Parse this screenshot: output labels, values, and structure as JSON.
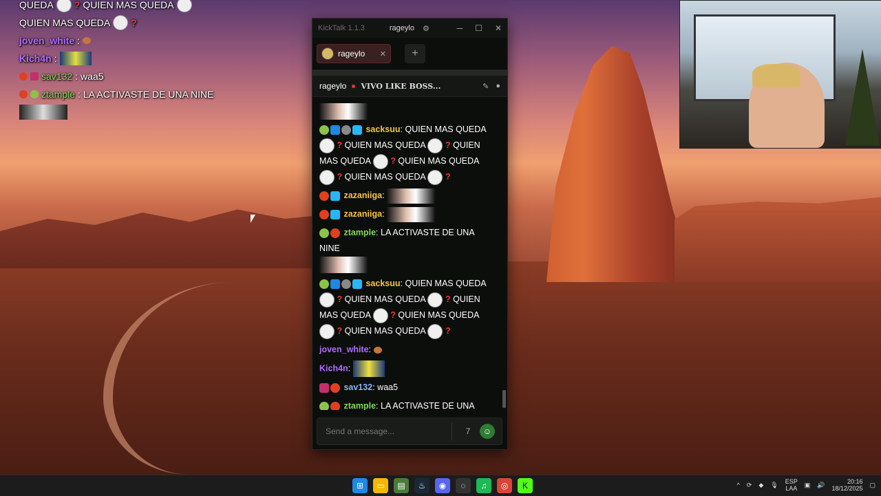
{
  "overlay": {
    "lines": [
      {
        "text1": "QUEDA",
        "text2": "QUIEN MAS QUEDA"
      },
      {
        "text1": "QUIEN MAS QUEDA"
      },
      {
        "user": "joven_white",
        "sep": ":"
      },
      {
        "user": "Kich4n",
        "sep": ":"
      },
      {
        "user": "sav132",
        "sep": ":",
        "text": "waa5"
      },
      {
        "user": "ztample",
        "sep": ":",
        "text": "LA ACTIVASTE DE UNA NINE"
      }
    ]
  },
  "kicktalk": {
    "app_title": "KickTalk 1.1.3",
    "account": "rageylo",
    "window_controls": {
      "minimize": "─",
      "maximize": "☐",
      "close": "✕"
    },
    "tab": {
      "label": "rageylo",
      "close": "✕"
    },
    "add_tab": "+",
    "channel": {
      "name": "rageylo",
      "stream_title": "VIVO LIKE BOSS..."
    },
    "messages": [
      {
        "user": "sacksuu",
        "sep": ":",
        "t1": "QUIEN MAS QUEDA",
        "t2": "QUIEN MAS QUEDA",
        "t3": "QUIEN",
        "t4": "MAS QUEDA",
        "t5": "QUIEN MAS QUEDA",
        "t6": "QUIEN MAS QUEDA"
      },
      {
        "user": "zazaniiga",
        "sep": ":"
      },
      {
        "user": "zazaniiga",
        "sep": ":"
      },
      {
        "user": "ztample",
        "sep": ":",
        "text": "LA ACTIVASTE DE UNA NINE"
      },
      {
        "user": "sacksuu",
        "sep": ":",
        "t1": "QUIEN MAS QUEDA",
        "t2": "QUIEN MAS QUEDA",
        "t3": "QUIEN",
        "t4": "MAS QUEDA",
        "t5": "QUIEN MAS QUEDA",
        "t6": "QUIEN MAS QUEDA"
      },
      {
        "user": "joven_white",
        "sep": ":"
      },
      {
        "user": "Kich4n",
        "sep": ":"
      },
      {
        "user": "sav132",
        "sep": ":",
        "text": "waa5"
      },
      {
        "user": "ztample",
        "sep": ":",
        "text": "LA ACTIVASTE DE UNA NINE"
      }
    ],
    "input": {
      "placeholder": "Send a message..."
    },
    "qmark": "?"
  },
  "taskbar": {
    "lang": "ESP",
    "layout": "LAA",
    "time": "20:16",
    "date": "18/12/2025",
    "chevron": "^"
  },
  "icons": {
    "settings": "gear-icon",
    "pin": "pin-icon",
    "user": "user-icon",
    "emote": "emote-icon"
  }
}
